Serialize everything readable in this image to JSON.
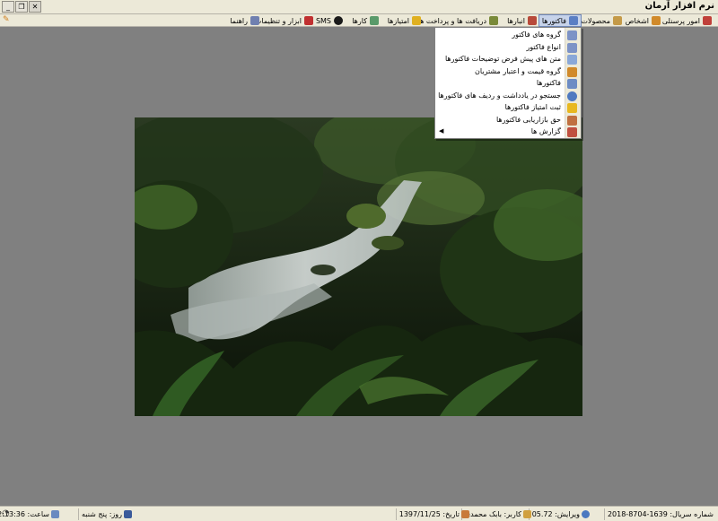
{
  "window": {
    "title": "نرم افزار آرمان",
    "minimize_glyph": "_",
    "restore_glyph": "❐",
    "close_glyph": "✕",
    "corner_glyph": "✎"
  },
  "menubar": {
    "items": [
      {
        "label": "امور پرسنلی",
        "icon": "staff-icon",
        "color": "#c0403a"
      },
      {
        "label": "اشخاص",
        "icon": "people-icon",
        "color": "#d18a2a"
      },
      {
        "label": "محصولات",
        "icon": "box-icon",
        "color": "#c49a48"
      },
      {
        "label": "فاکتورها",
        "icon": "invoice-icon",
        "color": "#5b7fc4"
      },
      {
        "label": "انبارها",
        "icon": "warehouse-icon",
        "color": "#b84a3a"
      },
      {
        "label": "دریافت ها و پرداخت ها",
        "icon": "payment-icon",
        "color": "#7a8a3a"
      },
      {
        "label": "امتیازها",
        "icon": "star-icon",
        "color": "#e0b020"
      },
      {
        "label": "کارها",
        "icon": "tasks-icon",
        "color": "#5a9a6a"
      },
      {
        "label": "SMS",
        "icon": "sms-icon",
        "color": "#1a1a1a"
      },
      {
        "label": "ابزار و تنظیمات",
        "icon": "tools-icon",
        "color": "#c03030"
      },
      {
        "label": "راهنما",
        "icon": "help-icon",
        "color": "#7080b0"
      }
    ]
  },
  "dropdown": {
    "items": [
      {
        "label": "گروه های فاکتور",
        "icon": "invoice-group-icon",
        "color": "#7d93c6",
        "submenu": false
      },
      {
        "label": "انواع فاکتور",
        "icon": "invoice-type-icon",
        "color": "#7d93c6",
        "submenu": false
      },
      {
        "label": "متن های پیش فرض توضیحات فاکتورها",
        "icon": "text-template-icon",
        "color": "#8aa8d8",
        "submenu": false
      },
      {
        "label": "گروه قیمت و اعتبار مشتریان",
        "icon": "customer-credit-icon",
        "color": "#d18a2a",
        "submenu": false
      },
      {
        "label": "فاکتورها",
        "icon": "invoices-icon",
        "color": "#6d8cc4",
        "submenu": false
      },
      {
        "label": "جستجو در یادداشت و ردیف های فاکتورها",
        "icon": "search-icon",
        "color": "#4f79c0",
        "submenu": false
      },
      {
        "label": "ثبت امتیاز فاکتورها",
        "icon": "star-icon",
        "color": "#e8b820",
        "submenu": false
      },
      {
        "label": "حق بازاریابی فاکتورها",
        "icon": "marketing-icon",
        "color": "#c07040",
        "submenu": false
      },
      {
        "label": "گزارش ها",
        "icon": "report-icon",
        "color": "#c05040",
        "submenu": true
      }
    ],
    "submenu_glyph": "◀"
  },
  "statusbar": {
    "panels": [
      {
        "label": "شماره سریال: 1639-8704-2018",
        "icon": "",
        "color": ""
      },
      {
        "label": "ویرایش: 05.72",
        "icon": "globe-icon",
        "color": "#4a78c0"
      },
      {
        "label": "کاربر: بابک محمدی",
        "icon": "edit-icon",
        "color": "#d0a040"
      },
      {
        "label": "تاریخ: 1397/11/25",
        "icon": "user-icon",
        "color": "#c87a3a"
      },
      {
        "label": "روز: پنج شنبه",
        "icon": "calendar-icon",
        "color": "#3a5a9a"
      },
      {
        "label": "ساعت: 12:13:36",
        "icon": "calendar-day-icon",
        "color": "#6a8ac0"
      }
    ],
    "clock_glyph": "◔"
  }
}
